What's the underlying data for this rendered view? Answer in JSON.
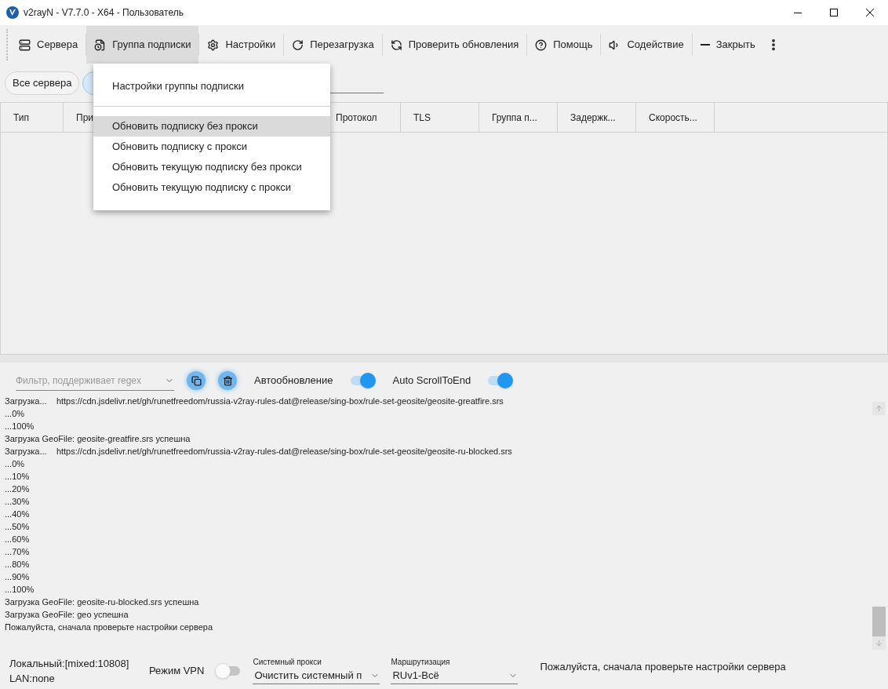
{
  "window": {
    "title": "v2rayN - V7.7.0 - X64 - Пользователь"
  },
  "toolbar": {
    "items": [
      {
        "label": "Сервера",
        "selected": false
      },
      {
        "label": "Группа подписки",
        "selected": true
      },
      {
        "label": "Настройки",
        "selected": false
      },
      {
        "label": "Перезагрузка",
        "selected": false
      },
      {
        "label": "Проверить обновления",
        "selected": false
      },
      {
        "label": "Помощь",
        "selected": false
      },
      {
        "label": "Содействие",
        "selected": false
      },
      {
        "label": "Закрыть",
        "selected": false
      }
    ]
  },
  "filter_chips": [
    {
      "label": "Все сервера",
      "selected": false
    },
    {
      "selected": true
    }
  ],
  "table": {
    "columns": [
      "Тип",
      "При",
      "Протокол",
      "TLS",
      "Группа п...",
      "Задержк...",
      "Скорость..."
    ]
  },
  "menu": {
    "items": [
      {
        "kind": "item",
        "label": "Настройки группы подписки",
        "selected": false
      },
      {
        "kind": "separator"
      },
      {
        "kind": "item",
        "label": "Обновить подписку без прокси",
        "selected": true
      },
      {
        "kind": "item",
        "label": "Обновить подписку с прокси",
        "selected": false
      },
      {
        "kind": "item",
        "label": "Обновить текущую подписку без прокси",
        "selected": false
      },
      {
        "kind": "item",
        "label": "Обновить текущую подписку с прокси",
        "selected": false
      }
    ]
  },
  "log": {
    "filter_placeholder": "Фильтр, поддерживает regex",
    "toggles": [
      {
        "label": "Автообновление",
        "on": true
      },
      {
        "label": "Auto ScrollToEnd",
        "on": true
      }
    ],
    "lines": [
      "Загрузка...    https://cdn.jsdelivr.net/gh/runetfreedom/russia-v2ray-rules-dat@release/sing-box/rule-set-geosite/geosite-greatfire.srs",
      "...0%",
      "...100%",
      "Загрузка GeoFile: geosite-greatfire.srs успешна",
      "Загрузка...    https://cdn.jsdelivr.net/gh/runetfreedom/russia-v2ray-rules-dat@release/sing-box/rule-set-geosite/geosite-ru-blocked.srs",
      "...0%",
      "...10%",
      "...20%",
      "...30%",
      "...40%",
      "...50%",
      "...60%",
      "...70%",
      "...80%",
      "...90%",
      "...100%",
      "Загрузка GeoFile: geosite-ru-blocked.srs успешна",
      "Загрузка GeoFile: geo успешна",
      "Пожалуйста, сначала проверьте настройки сервера"
    ]
  },
  "status_bar": {
    "local": "Локальный:[mixed:10808]",
    "lan": "LAN:none",
    "vpn": {
      "label": "Режим VPN",
      "on": false
    },
    "system_proxy": {
      "label": "Системный прокси",
      "value": "Очистить системный п"
    },
    "routing": {
      "label": "Маршрутизация",
      "value": "RUv1-Всё"
    },
    "message": "Пожалуйста, сначала проверьте настройки сервера"
  }
}
